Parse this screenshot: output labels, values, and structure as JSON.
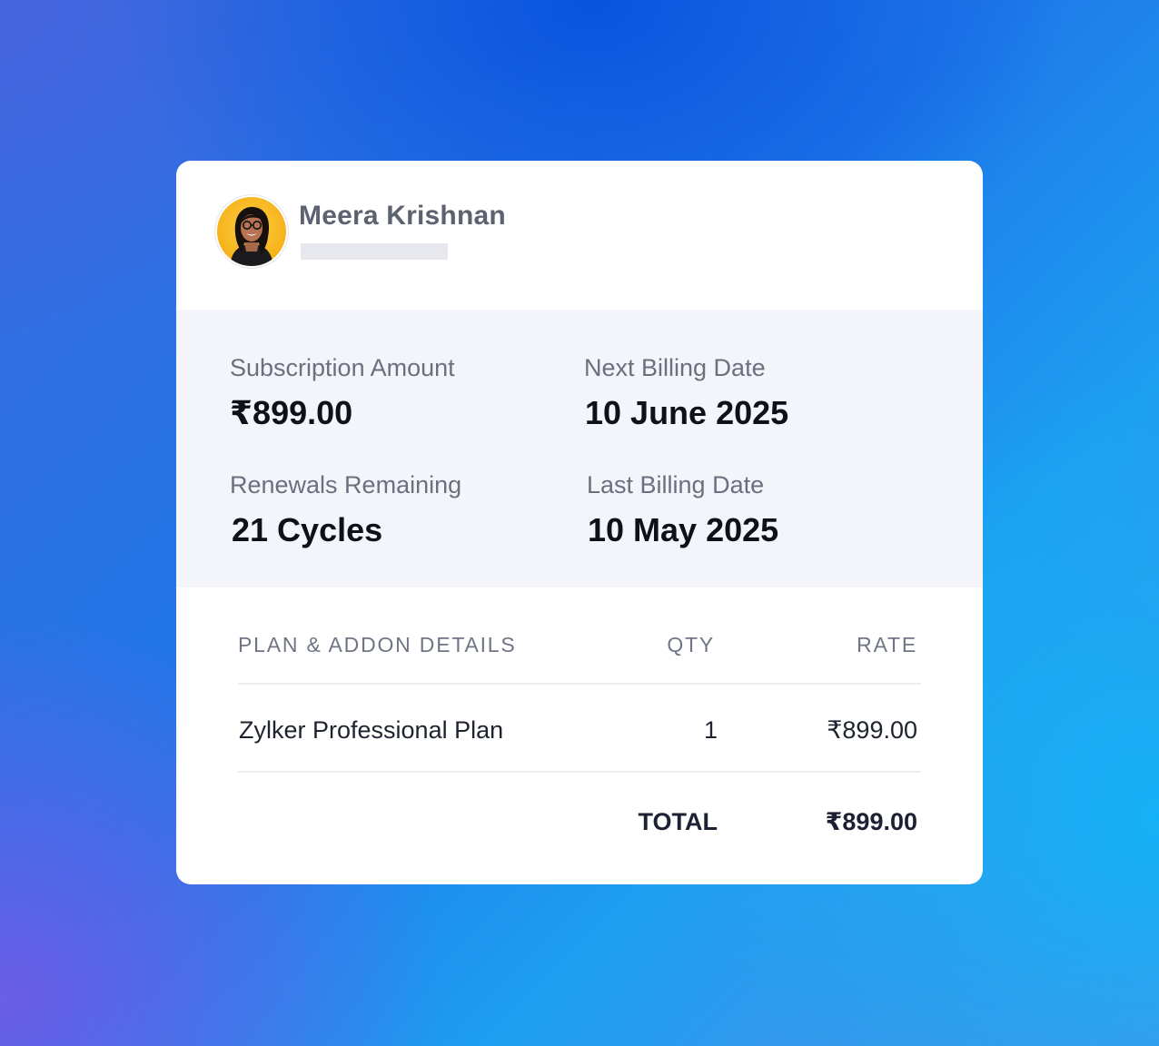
{
  "customer": {
    "name": "Meera Krishnan"
  },
  "summary": {
    "subscription_amount_label": "Subscription Amount",
    "subscription_amount_value": "₹899.00",
    "next_billing_label": "Next Billing Date",
    "next_billing_value": "10 June 2025",
    "renewals_label": "Renewals Remaining",
    "renewals_value": "21 Cycles",
    "last_billing_label": "Last Billing Date",
    "last_billing_value": "10 May 2025"
  },
  "table": {
    "headers": {
      "details": "PLAN & ADDON DETAILS",
      "qty": "QTY",
      "rate": "RATE"
    },
    "rows": [
      {
        "name": "Zylker Professional Plan",
        "qty": "1",
        "rate": "₹899.00"
      }
    ],
    "total_label": "TOTAL",
    "total_value": "₹899.00"
  },
  "colors": {
    "card_background": "#ffffff",
    "summary_background": "#f3f5fa",
    "avatar_background": "#f6b21a"
  },
  "icons": {
    "avatar": "customer-avatar-photo"
  }
}
